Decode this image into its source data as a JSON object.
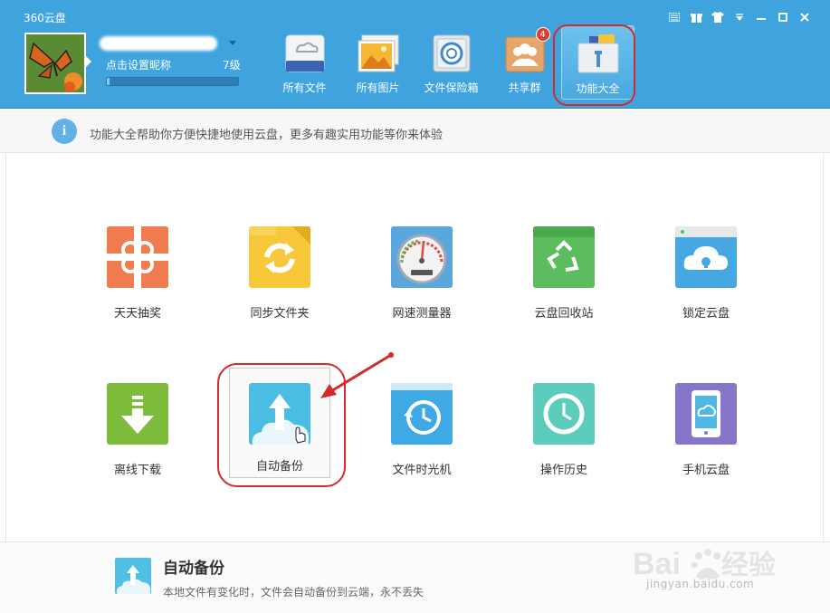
{
  "window": {
    "title": "360云盘",
    "controls": [
      "menu-icon",
      "gift-icon",
      "shirt-icon",
      "dropdown-icon",
      "minimize-icon",
      "maximize-icon",
      "close-icon"
    ]
  },
  "user": {
    "nickname_prompt": "点击设置昵称",
    "level": "7级",
    "progress": 0.02
  },
  "nav": {
    "items": [
      {
        "label": "所有文件",
        "icon": "cloud-drive-icon"
      },
      {
        "label": "所有图片",
        "icon": "picture-icon"
      },
      {
        "label": "文件保险箱",
        "icon": "safe-icon"
      },
      {
        "label": "共享群",
        "icon": "group-icon",
        "badge": "4"
      },
      {
        "label": "功能大全",
        "icon": "toolbox-icon",
        "active": true
      }
    ]
  },
  "info": {
    "text": "功能大全帮助你方便快捷地使用云盘，更多有趣实用功能等你来体验"
  },
  "tools": {
    "row1": [
      {
        "label": "天天抽奖",
        "icon": "gift-box-icon",
        "color": "#f07c50"
      },
      {
        "label": "同步文件夹",
        "icon": "sync-folder-icon",
        "color": "#f6c83a"
      },
      {
        "label": "网速测量器",
        "icon": "speedometer-icon",
        "color": "#5aa7dd"
      },
      {
        "label": "云盘回收站",
        "icon": "recycle-icon",
        "color": "#5bbd5e"
      },
      {
        "label": "锁定云盘",
        "icon": "lock-cloud-icon",
        "color": "#47a7e3"
      }
    ],
    "row2": [
      {
        "label": "离线下载",
        "icon": "download-icon",
        "color": "#7dbb3b"
      },
      {
        "label": "自动备份",
        "icon": "cloud-upload-icon",
        "color": "#49bde4",
        "selected": true
      },
      {
        "label": "文件时光机",
        "icon": "time-machine-icon",
        "color": "#3fa9e6"
      },
      {
        "label": "操作历史",
        "icon": "clock-icon",
        "color": "#5ccdbd"
      },
      {
        "label": "手机云盘",
        "icon": "phone-cloud-icon",
        "color": "#8675c9"
      }
    ]
  },
  "description": {
    "title": "自动备份",
    "text": "本地文件有变化时，文件会自动备份到云端，永不丢失"
  },
  "watermark": {
    "sub": "jingyan.baidu.com"
  },
  "colors": {
    "header": "#3fa4de",
    "highlight": "#d32a2a"
  }
}
